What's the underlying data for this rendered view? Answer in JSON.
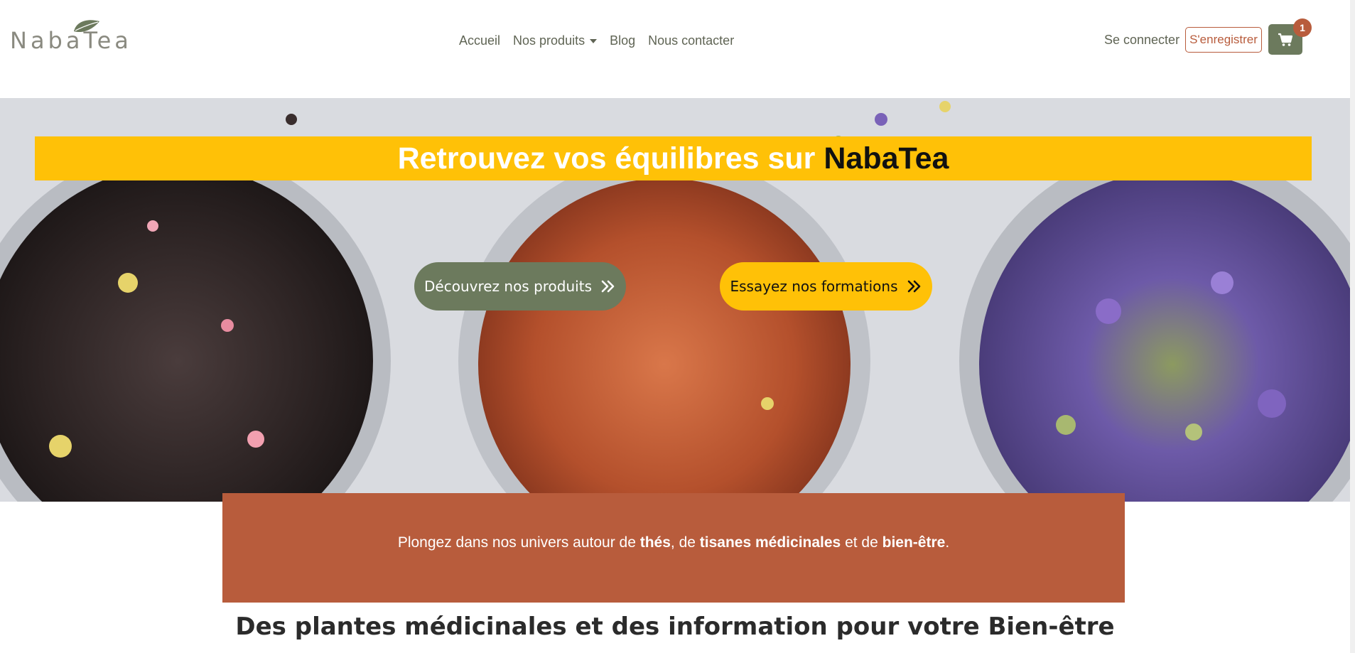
{
  "brand": {
    "logo_text": "NabaTea",
    "colors": {
      "olive": "#6c7a5d",
      "yellow": "#ffc107",
      "terracotta": "#b85c3c"
    }
  },
  "nav": {
    "links": [
      {
        "label": "Accueil"
      },
      {
        "label": "Nos produits",
        "dropdown": true
      },
      {
        "label": "Blog"
      },
      {
        "label": "Nous contacter"
      }
    ],
    "signin_label": "Se connecter",
    "register_label": "S'enregistrer",
    "cart_icon": "cart-icon",
    "cart_count": "1"
  },
  "hero": {
    "title_prefix": "Retrouvez vos équilibres sur ",
    "title_brand": "NabaTea",
    "buttons": {
      "products_label": "Découvrez nos produits",
      "formations_label": "Essayez nos formations"
    }
  },
  "intro": {
    "p1": "Plongez dans nos univers autour de ",
    "b1": "thés",
    "p2": ", de ",
    "b2": "tisanes médicinales",
    "p3": " et de ",
    "b3": "bien-être",
    "p4": "."
  },
  "section": {
    "p1": "Des ",
    "b1": "plantes médicinales",
    "p2": " et des information pour votre Bien-être"
  }
}
